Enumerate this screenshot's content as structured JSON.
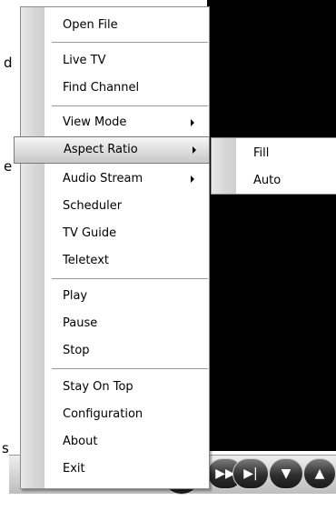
{
  "background_text": {
    "right_a": "d",
    "right_b": "e",
    "right_c": "s"
  },
  "menu": {
    "items": [
      {
        "label": "Open File"
      },
      {
        "label": "Live TV"
      },
      {
        "label": "Find Channel"
      },
      {
        "label": "View Mode",
        "has_submenu": true
      },
      {
        "label": "Aspect Ratio",
        "has_submenu": true,
        "active": true
      },
      {
        "label": "Audio Stream",
        "has_submenu": true
      },
      {
        "label": "Scheduler"
      },
      {
        "label": "TV Guide"
      },
      {
        "label": "Teletext"
      },
      {
        "label": "Play"
      },
      {
        "label": "Pause"
      },
      {
        "label": "Stop"
      },
      {
        "label": "Stay On Top"
      },
      {
        "label": "Configuration"
      },
      {
        "label": "About"
      },
      {
        "label": "Exit"
      }
    ]
  },
  "submenu": {
    "items": [
      {
        "label": "Fill"
      },
      {
        "label": "Auto"
      }
    ]
  },
  "controls": {
    "next_icon": "▶|",
    "down_icon": "▼",
    "up_icon": "▲"
  },
  "colors": {
    "video_background": "#000000",
    "menu_gutter": "#d6d6d6",
    "highlight": "#c8c8c8"
  }
}
